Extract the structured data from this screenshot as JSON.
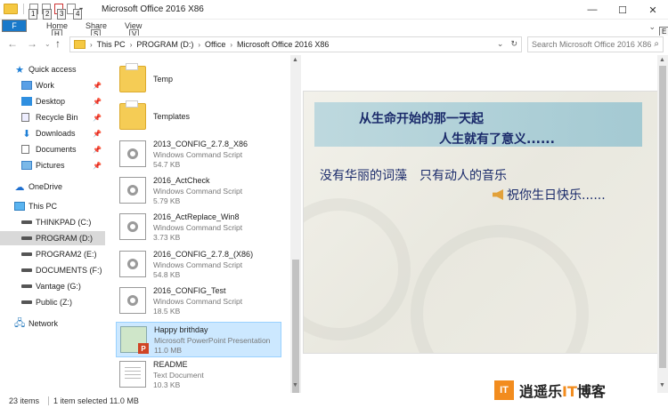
{
  "window": {
    "title": "Microsoft Office 2016 X86",
    "controls": [
      "—",
      "☐",
      "✕"
    ],
    "qat_keytips": [
      "1",
      "2",
      "3",
      "4"
    ]
  },
  "ribbon": {
    "file_label": "F",
    "tabs": [
      {
        "label": "Home",
        "keytip": "H"
      },
      {
        "label": "Share",
        "keytip": "S"
      },
      {
        "label": "View",
        "keytip": "V"
      }
    ],
    "expand_keytip": "E"
  },
  "address": {
    "crumbs": [
      "This PC",
      "PROGRAM (D:)",
      "Office",
      "Microsoft Office 2016 X86"
    ],
    "search_placeholder": "Search Microsoft Office 2016 X86"
  },
  "nav": {
    "quick_access": "Quick access",
    "quick_items": [
      {
        "label": "Work",
        "pinned": true
      },
      {
        "label": "Desktop",
        "pinned": true
      },
      {
        "label": "Recycle Bin",
        "pinned": true
      },
      {
        "label": "Downloads",
        "pinned": true
      },
      {
        "label": "Documents",
        "pinned": true
      },
      {
        "label": "Pictures",
        "pinned": true
      }
    ],
    "onedrive": "OneDrive",
    "this_pc": "This PC",
    "drives": [
      {
        "label": "THINKPAD (C:)"
      },
      {
        "label": "PROGRAM (D:)"
      },
      {
        "label": "PROGRAM2 (E:)"
      },
      {
        "label": "DOCUMENTS (F:)"
      },
      {
        "label": "Vantage (G:)"
      },
      {
        "label": "Public (Z:)"
      }
    ],
    "network": "Network"
  },
  "files": [
    {
      "name": "Temp",
      "type": "",
      "size": "",
      "kind": "folder"
    },
    {
      "name": "Templates",
      "type": "",
      "size": "",
      "kind": "folder"
    },
    {
      "name": "2013_CONFIG_2.7.8_X86",
      "type": "Windows Command Script",
      "size": "54.7 KB",
      "kind": "script"
    },
    {
      "name": "2016_ActCheck",
      "type": "Windows Command Script",
      "size": "5.79 KB",
      "kind": "script"
    },
    {
      "name": "2016_ActReplace_Win8",
      "type": "Windows Command Script",
      "size": "3.73 KB",
      "kind": "script"
    },
    {
      "name": "2016_CONFIG_2.7.8_(X86)",
      "type": "Windows Command Script",
      "size": "54.8 KB",
      "kind": "script"
    },
    {
      "name": "2016_CONFIG_Test",
      "type": "Windows Command Script",
      "size": "18.5 KB",
      "kind": "script"
    },
    {
      "name": "Happy brithday",
      "type": "Microsoft PowerPoint Presentation",
      "size": "11.0 MB",
      "kind": "ppt"
    },
    {
      "name": "README",
      "type": "Text Document",
      "size": "10.3 KB",
      "kind": "text"
    }
  ],
  "preview": {
    "line1": "从生命开始的那一天起",
    "line2": "人生就有了意义......",
    "line3": "没有华丽的词藻　只有动人的音乐",
    "line4": "祝你生日快乐......"
  },
  "status": {
    "count": "23 items",
    "selected": "1 item selected",
    "size": "11.0 MB"
  },
  "watermark": {
    "logo": "IT",
    "text_a": "逍遥乐",
    "text_it": "IT",
    "text_b": "博客"
  }
}
